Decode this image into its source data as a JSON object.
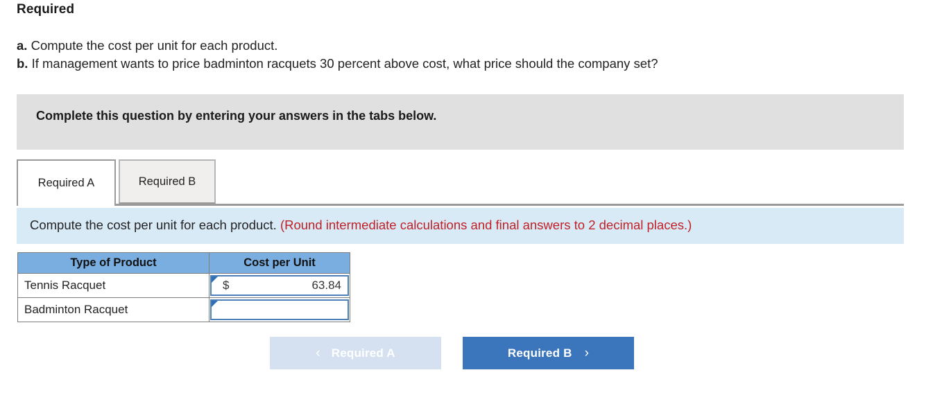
{
  "heading": "Required",
  "requirements": [
    {
      "marker": "a.",
      "text": " Compute the cost per unit for each product."
    },
    {
      "marker": "b.",
      "text": " If management wants to price badminton racquets 30 percent above cost, what price should the company set?"
    }
  ],
  "banner": {
    "text": "Complete this question by entering your answers in the tabs below."
  },
  "tabs": [
    {
      "label": "Required A",
      "state": "active"
    },
    {
      "label": "Required B",
      "state": "inactive"
    }
  ],
  "instruction": {
    "prompt": "Compute the cost per unit for each product.",
    "hint": "(Round intermediate calculations and final answers to 2 decimal places.)"
  },
  "table": {
    "headers": [
      "Type of Product",
      "Cost per Unit"
    ],
    "rows": [
      {
        "product": "Tennis Racquet",
        "currency": "$",
        "value": "63.84"
      },
      {
        "product": "Badminton Racquet",
        "currency": "",
        "value": ""
      }
    ]
  },
  "nav": {
    "prev_label": "Required A",
    "prev_icon": "chevron-left-icon",
    "prev_chevron": "‹",
    "next_label": "Required B",
    "next_icon": "chevron-right-icon",
    "next_chevron": "›"
  },
  "colors": {
    "banner_gray": "#e0e0e0",
    "instruction_blue": "#d9eaf7",
    "hint_red": "#c02026",
    "table_header_blue": "#7aaee0",
    "input_border_blue": "#4a7fba",
    "button_active_blue": "#3b75bb",
    "button_disabled_blue": "#d5e1f0"
  }
}
